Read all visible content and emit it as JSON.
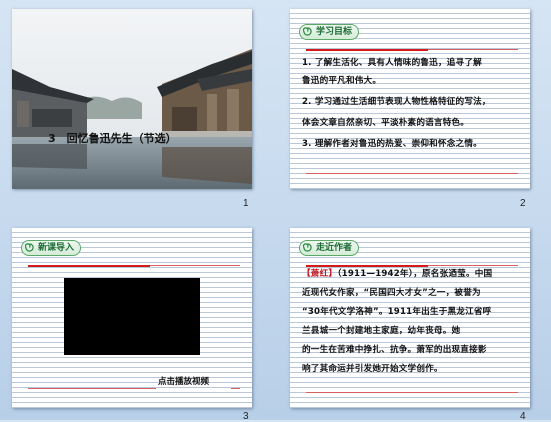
{
  "slides": [
    {
      "number": "1",
      "title_caption": "3　回忆鲁迅先生（节选）"
    },
    {
      "number": "2",
      "badge": "学习目标",
      "lines": [
        "1. 了解生活化、具有人情味的鲁迅，追寻了解",
        "鲁迅的平凡和伟大。",
        "2. 学习通过生活细节表现人物性格特征的写法，",
        "体会文章自然亲切、平淡朴素的语言特色。",
        "3. 理解作者对鲁迅的热爱、崇仰和怀念之情。"
      ]
    },
    {
      "number": "3",
      "badge": "新课导入",
      "video_label": "点击播放视频"
    },
    {
      "number": "4",
      "badge": "走近作者",
      "name_tag": "【萧红】",
      "lines_first_rest": "（1911—1942年），原名张迺莹。中国",
      "lines": [
        "近现代女作家，“民国四大才女”之一，被誉为",
        "“30年代文学洛神”。1911年出生于黑龙江省呼",
        "兰县城一个封建地主家庭，幼年丧母。她",
        "的一生在苦难中挣扎、抗争。萧军的出现直接影",
        "响了其命运并引发她开始文学创作。"
      ]
    }
  ],
  "colors": {
    "accent_red": "#d21b1b",
    "badge_green": "#1e6b36",
    "name_red": "#c4121b"
  },
  "icons": {
    "badge": "swirl-icon"
  }
}
